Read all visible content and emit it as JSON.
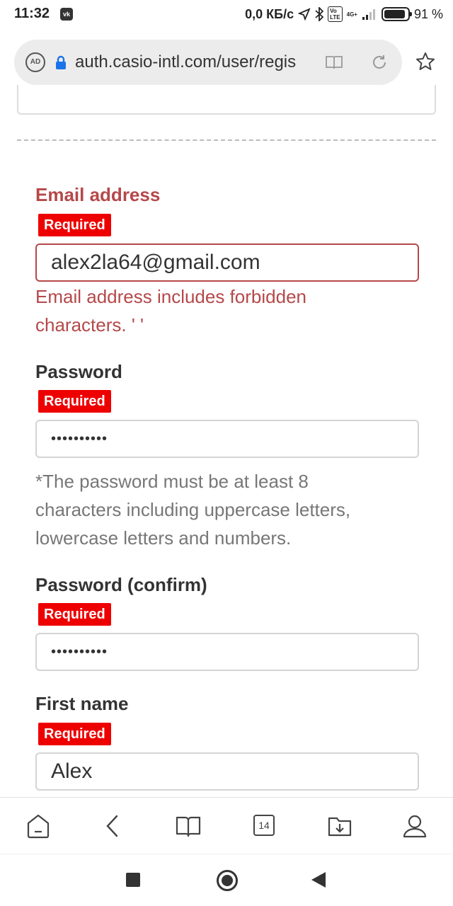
{
  "status_bar": {
    "time": "11:32",
    "vk_icon": "vk-icon",
    "speed": "0,0 КБ/с",
    "network": "4G+",
    "volte": "Vo LTE",
    "battery_level": 0.91,
    "battery_text": "91 %"
  },
  "browser": {
    "url": "auth.casio-intl.com/user/regis",
    "tabs_count": "14",
    "icons": [
      "adblock-icon",
      "lock-icon",
      "reader-mode-icon",
      "reload-icon",
      "star-icon",
      "home-icon",
      "back-icon",
      "bookmarks-icon",
      "tabs-icon",
      "downloads-icon",
      "profile-icon"
    ]
  },
  "form": {
    "email": {
      "label": "Email address",
      "badge": "Required",
      "value": "alex2la64@gmail.com",
      "error_line1": "Email address includes forbidden",
      "error_line2": "characters. ' '"
    },
    "password": {
      "label": "Password",
      "badge": "Required",
      "value": "••••••••••",
      "hint_line1": "*The password must be at least 8",
      "hint_line2": "characters including uppercase letters,",
      "hint_line3": "lowercase letters and numbers."
    },
    "password_confirm": {
      "label": "Password (confirm)",
      "badge": "Required",
      "value": "••••••••••"
    },
    "first_name": {
      "label": "First name",
      "badge": "Required",
      "value": "Alex"
    }
  },
  "colors": {
    "error": "#b5484a",
    "badge": "#ee0000",
    "hint": "#777777"
  }
}
